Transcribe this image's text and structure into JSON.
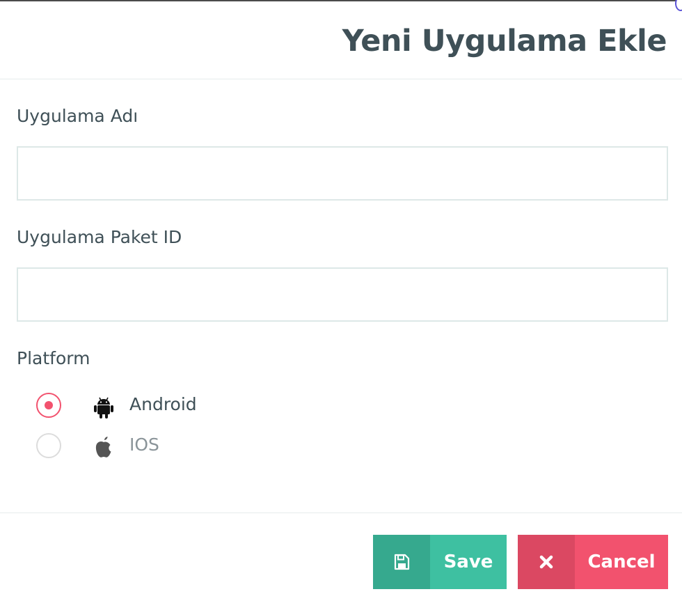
{
  "modal": {
    "title": "Yeni Uygulama Ekle"
  },
  "form": {
    "app_name_label": "Uygulama Adı",
    "app_name_value": "",
    "package_id_label": "Uygulama Paket ID",
    "package_id_value": "",
    "platform_label": "Platform",
    "platform_options": [
      {
        "label": "Android",
        "icon": "android-icon",
        "selected": true
      },
      {
        "label": "IOS",
        "icon": "apple-icon",
        "selected": false
      }
    ]
  },
  "footer": {
    "save_label": "Save",
    "save_icon": "save-icon",
    "cancel_label": "Cancel",
    "cancel_icon": "close-icon"
  },
  "colors": {
    "text": "#3f5057",
    "muted_text": "#8a9499",
    "accent_save": "#3ec0a1",
    "accent_cancel": "#f2526e",
    "input_border": "#dde8e7"
  }
}
